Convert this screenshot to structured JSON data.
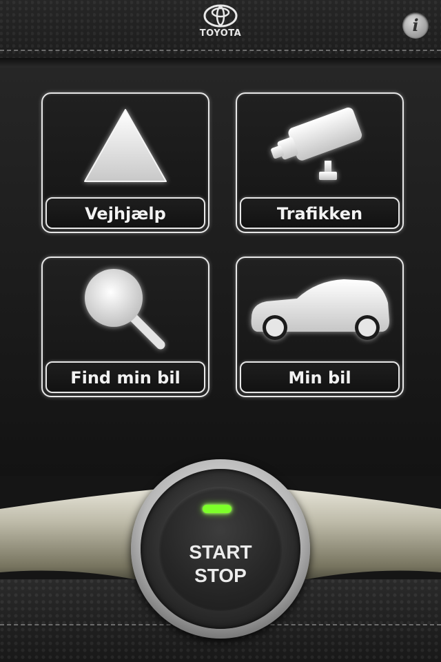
{
  "header": {
    "brand": "TOYOTA",
    "info_label": "i"
  },
  "tiles": [
    {
      "label": "Vejhjælp",
      "icon": "warning-triangle-icon"
    },
    {
      "label": "Trafikken",
      "icon": "traffic-camera-icon"
    },
    {
      "label": "Find min bil",
      "icon": "magnifier-icon"
    },
    {
      "label": "Min bil",
      "icon": "car-icon"
    }
  ],
  "start_button": {
    "line1": "START",
    "line2": "STOP",
    "led_color": "#7dff2a"
  },
  "colors": {
    "background": "#1a1a1a",
    "tile_border": "#e8e8e8",
    "text": "#f2f2f2"
  }
}
